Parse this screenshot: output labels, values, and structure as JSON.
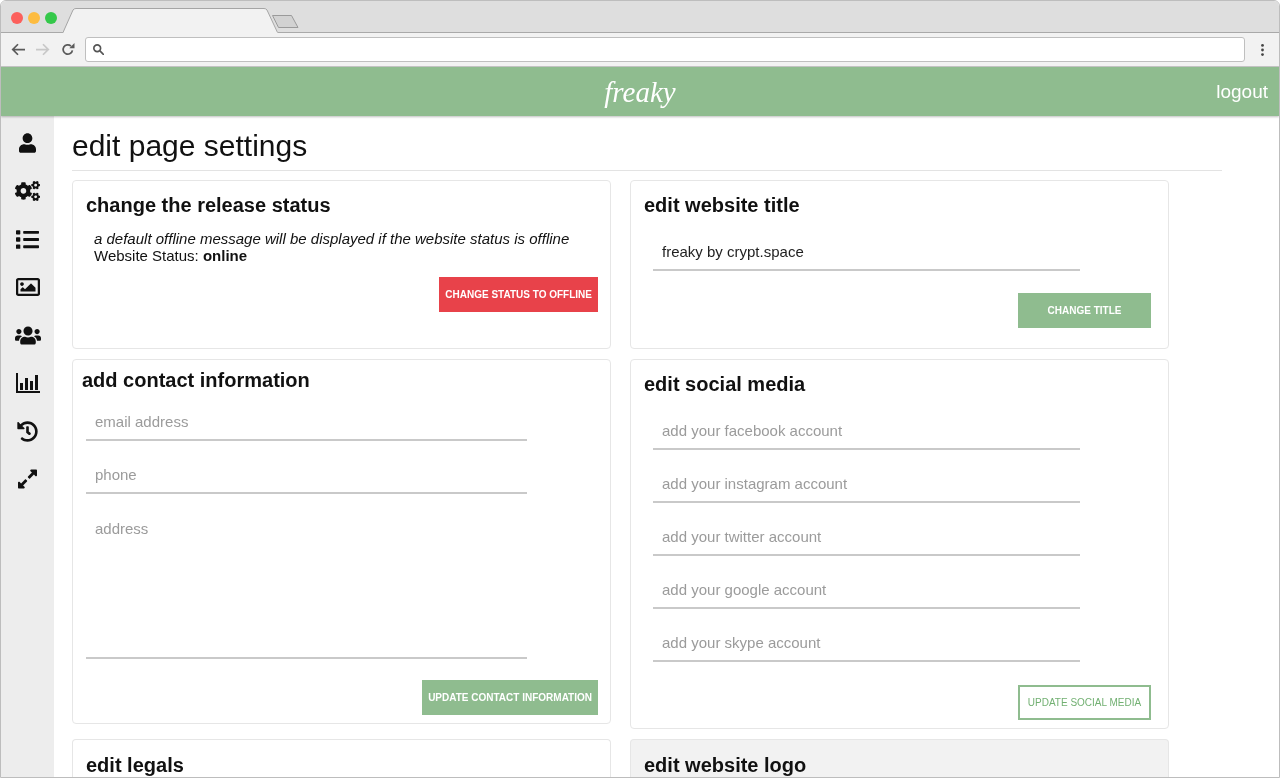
{
  "browser": {
    "nav_buttons": [
      {
        "kind": "back",
        "disabled": false
      },
      {
        "kind": "forward",
        "disabled": true
      },
      {
        "kind": "reload",
        "disabled": false
      }
    ]
  },
  "header": {
    "logo": "freaky",
    "logout": "logout"
  },
  "sidebar": {
    "items": [
      {
        "kind": "user"
      },
      {
        "kind": "gears"
      },
      {
        "kind": "list"
      },
      {
        "kind": "image"
      },
      {
        "kind": "users"
      },
      {
        "kind": "chart"
      },
      {
        "kind": "history"
      },
      {
        "kind": "expand"
      }
    ]
  },
  "page_title": "edit page settings",
  "cards": [
    {
      "kind": "status",
      "highlighted": false,
      "title": "change the release status",
      "note": "a default offline message will be displayed if the website status is offline",
      "status": "Website Status: **online**",
      "button": "CHANGE STATUS TO OFFLINE"
    },
    {
      "kind": "single_field",
      "highlighted": false,
      "title": "edit website title",
      "field": {
        "kind": "input",
        "value": "freaky by crypt.space"
      },
      "button": "CHANGE TITLE"
    },
    {
      "kind": "contact",
      "highlighted": false,
      "title": "add contact information",
      "fields": [
        {
          "kind": "input",
          "placeholder": "email address"
        },
        {
          "kind": "input",
          "placeholder": "phone"
        },
        {
          "kind": "textarea",
          "placeholder": "address"
        }
      ],
      "button": "UPDATE CONTACT INFORMATION"
    },
    {
      "kind": "social",
      "highlighted": false,
      "title": "edit social media",
      "fields": [
        {
          "kind": "input",
          "placeholder": "add your facebook account"
        },
        {
          "kind": "input",
          "placeholder": "add your instagram account"
        },
        {
          "kind": "input",
          "placeholder": "add your twitter account"
        },
        {
          "kind": "input",
          "placeholder": "add your google account"
        },
        {
          "kind": "input",
          "placeholder": "add your skype account"
        }
      ],
      "button": "UPDATE SOCIAL MEDIA"
    },
    {
      "kind": "header_only",
      "highlighted": false,
      "title": "edit legals"
    },
    {
      "kind": "header_only",
      "highlighted": true,
      "title": "edit website logo"
    }
  ]
}
